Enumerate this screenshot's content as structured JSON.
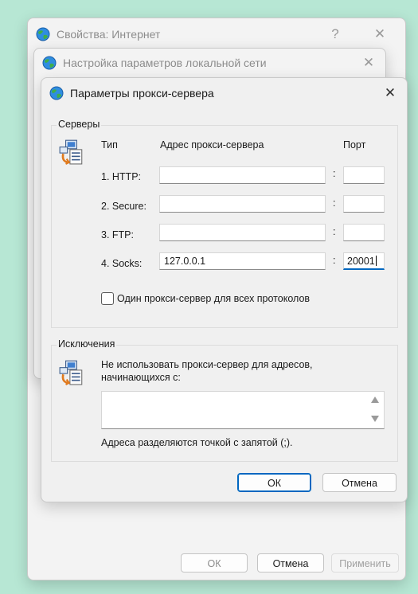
{
  "window1": {
    "title": "Свойства: Интернет",
    "help": "?",
    "close": "✕",
    "ok_label": "ОК",
    "cancel_label": "Отмена",
    "apply_label": "Применить"
  },
  "window2": {
    "title": "Настройка параметров локальной сети",
    "close": "✕"
  },
  "dialog": {
    "title": "Параметры прокси-сервера",
    "close": "✕",
    "servers": {
      "group_label": "Серверы",
      "col_type": "Тип",
      "col_address": "Адрес прокси-сервера",
      "col_port": "Порт",
      "colon": ":",
      "rows": [
        {
          "label": "1. HTTP:",
          "address": "",
          "port": ""
        },
        {
          "label": "2. Secure:",
          "address": "",
          "port": ""
        },
        {
          "label": "3. FTP:",
          "address": "",
          "port": ""
        },
        {
          "label": "4. Socks:",
          "address": "127.0.0.1",
          "port": "20001"
        }
      ],
      "same_proxy_label": "Один прокси-сервер для всех протоколов",
      "same_proxy_checked": false
    },
    "exceptions": {
      "group_label": "Исключения",
      "description_line1": "Не использовать прокси-сервер для адресов,",
      "description_line2": "начинающихся с:",
      "value": "",
      "hint": "Адреса разделяются точкой с запятой (;)."
    },
    "ok_label": "ОК",
    "cancel_label": "Отмена"
  },
  "colors": {
    "accent": "#0067c0",
    "background": "#b7e7d4"
  },
  "icons": {
    "title": "globe-icon",
    "servers": "network-computers-icon",
    "exceptions": "network-computers-icon"
  }
}
